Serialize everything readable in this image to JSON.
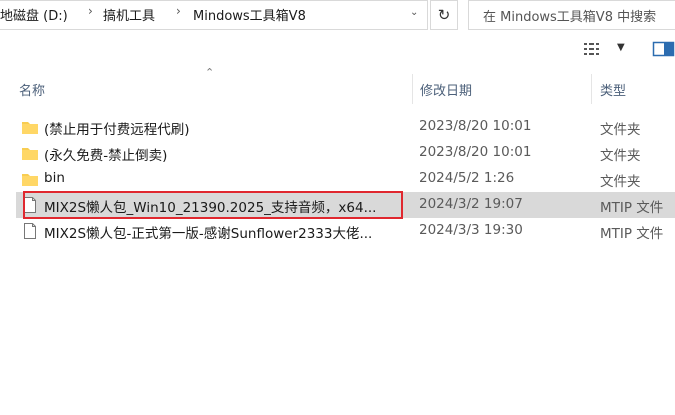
{
  "address": {
    "crumbs": [
      "地磁盘 (D:)",
      "搞机工具",
      "Mindows工具箱V8"
    ]
  },
  "search": {
    "placeholder": "在 Mindows工具箱V8 中搜索"
  },
  "columns": {
    "name": "名称",
    "date": "修改日期",
    "type": "类型"
  },
  "files": [
    {
      "name": "(禁止用于付费远程代刷)",
      "date": "2023/8/20 10:01",
      "type": "文件夹",
      "icon": "folder-icon"
    },
    {
      "name": "(永久免费-禁止倒卖)",
      "date": "2023/8/20 10:01",
      "type": "文件夹",
      "icon": "folder-icon"
    },
    {
      "name": "bin",
      "date": "2024/5/2 1:26",
      "type": "文件夹",
      "icon": "folder-icon"
    },
    {
      "name": "MIX2S懒人包_Win10_21390.2025_支持音频，x64...",
      "date": "2024/3/2 19:07",
      "type": "MTIP 文件",
      "icon": "file-icon",
      "selected": true
    },
    {
      "name": "MIX2S懒人包-正式第一版-感谢Sunflower2333大佬...",
      "date": "2024/3/3 19:30",
      "type": "MTIP 文件",
      "icon": "file-icon"
    }
  ],
  "colors": {
    "folder": "#f8cd52",
    "selected_row": "#d9d9d9",
    "highlight": "#e0282f",
    "header_text": "#4c607a"
  }
}
